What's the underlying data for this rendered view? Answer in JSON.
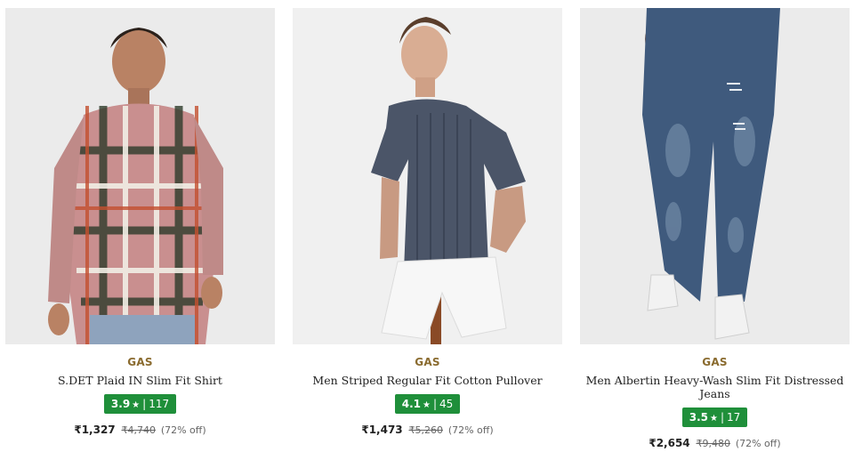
{
  "products": [
    {
      "brand": "GAS",
      "name": "S.DET Plaid IN Slim Fit Shirt",
      "rating": "3.9",
      "rating_count": "117",
      "price": "₹1,327",
      "mrp": "₹4,740",
      "discount": "(72% off)"
    },
    {
      "brand": "GAS",
      "name": "Men Striped Regular Fit Cotton Pullover",
      "rating": "4.1",
      "rating_count": "45",
      "price": "₹1,473",
      "mrp": "₹5,260",
      "discount": "(72% off)"
    },
    {
      "brand": "GAS",
      "name": "Men Albertin Heavy-Wash Slim Fit Distressed Jeans",
      "rating": "3.5",
      "rating_count": "17",
      "price": "₹2,654",
      "mrp": "₹9,480",
      "discount": "(72% off)"
    }
  ],
  "icons": {
    "rating_star": "star-icon"
  },
  "colors": {
    "rating_badge": "#1f8f3a",
    "brand_text": "#8a6b2f"
  }
}
